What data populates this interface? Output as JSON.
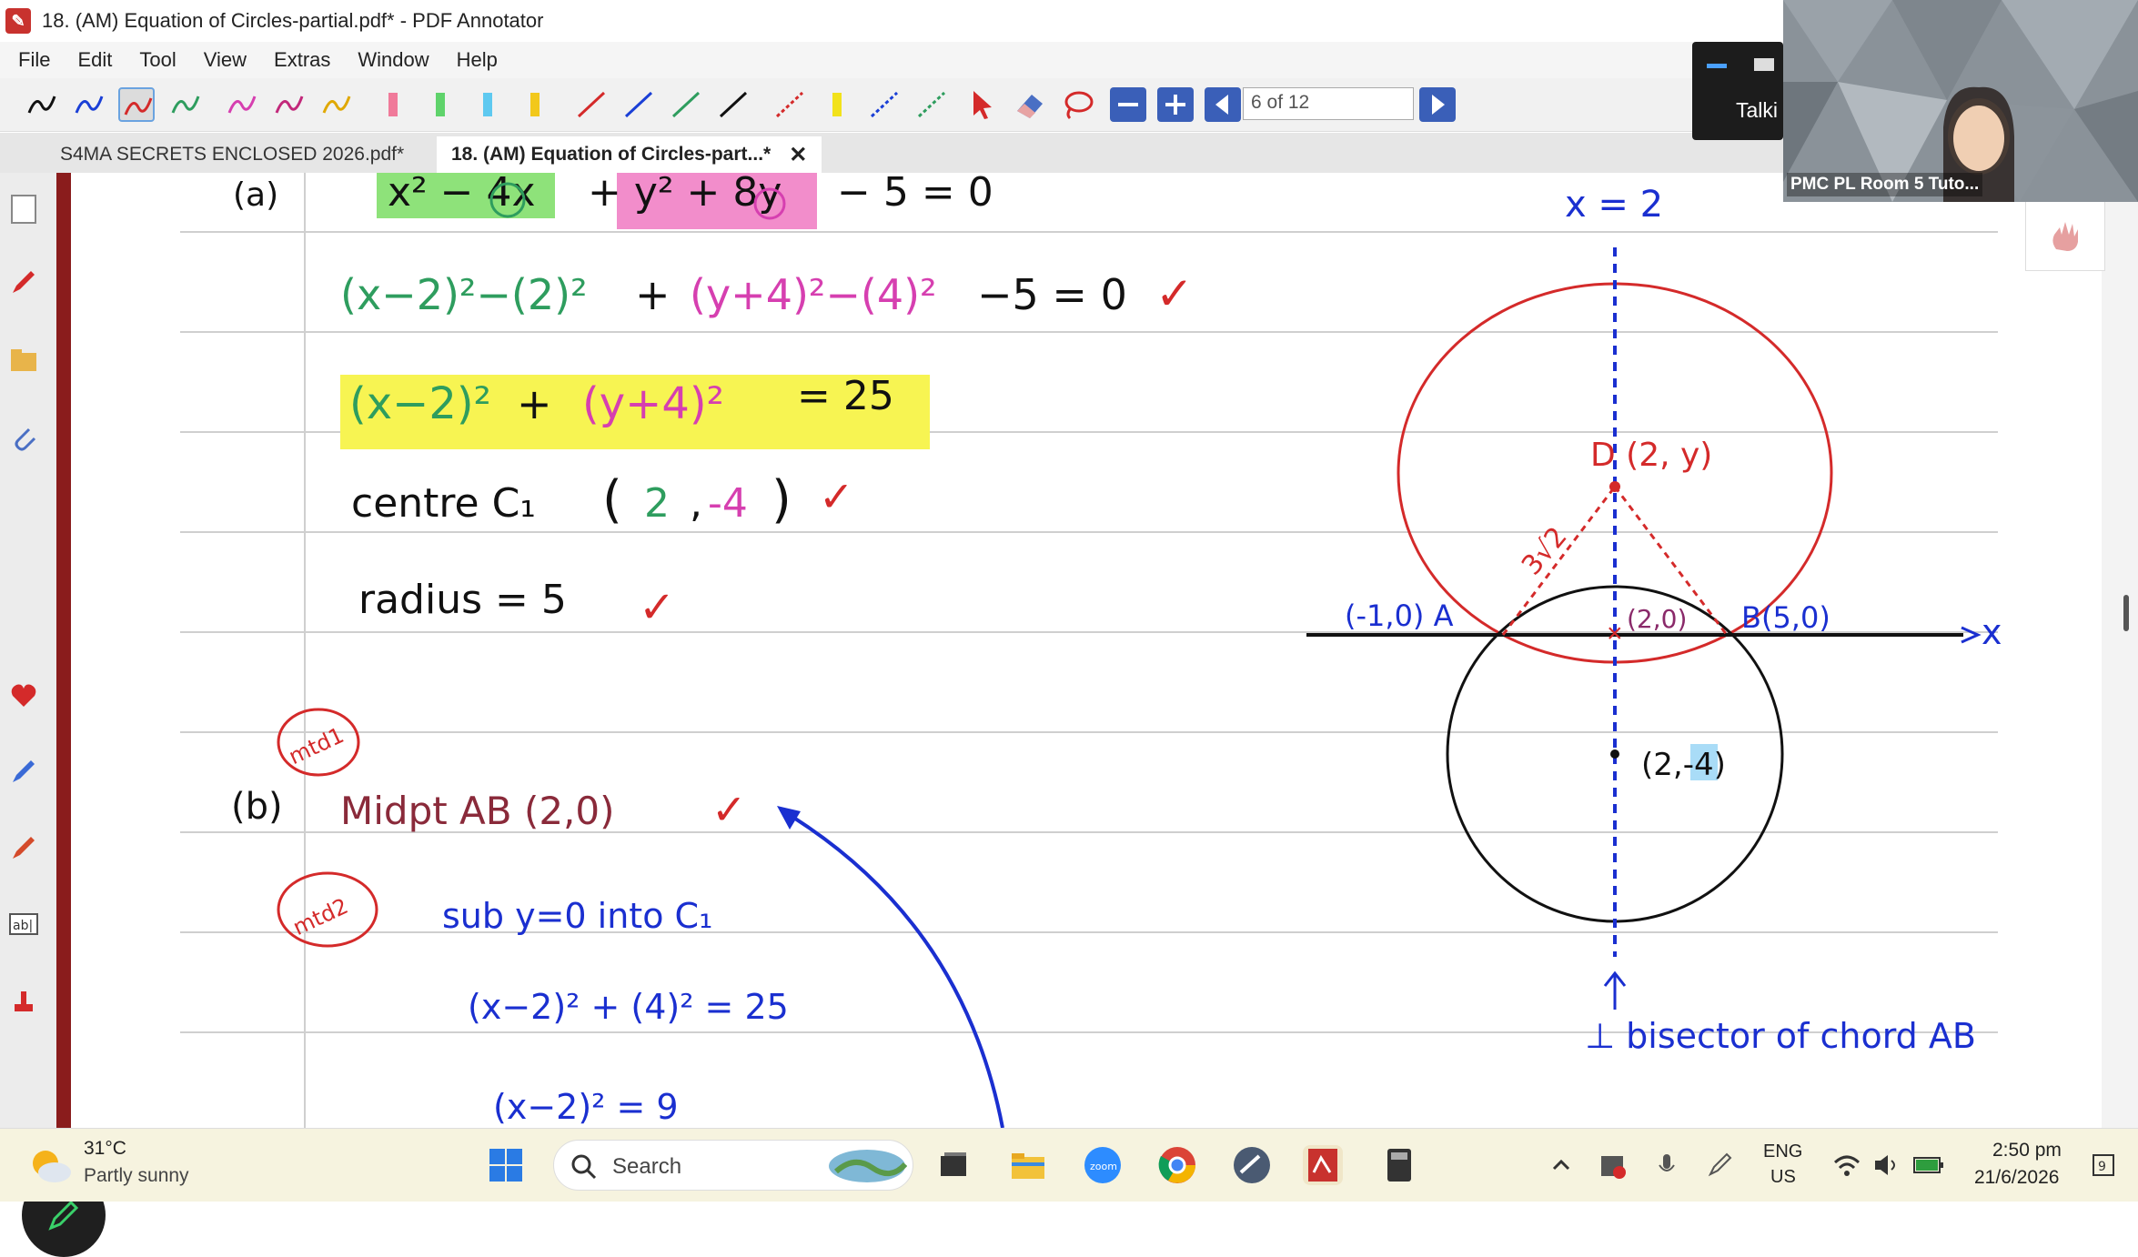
{
  "window": {
    "title": "18. (AM) Equation of Circles-partial.pdf* - PDF Annotator",
    "app_icon": "pdf-annotator-icon"
  },
  "menu": [
    "File",
    "Edit",
    "Tool",
    "View",
    "Extras",
    "Window",
    "Help"
  ],
  "toolbar": {
    "page_indicator": "6 of 12",
    "pen_colors": [
      "#111111",
      "#1a3fd6",
      "#d42a2a",
      "#2e9d5e",
      "#d63fb0",
      "#c2287a",
      "#e0a800"
    ],
    "highlighter_colors": [
      "#f07a9a",
      "#5fd36b",
      "#5ec9f0",
      "#f2c81b"
    ],
    "line_colors": [
      "#d42a2a",
      "#1a3fd6",
      "#2e9d5e",
      "#111111"
    ],
    "dashed_colors": [
      "#d42a2a",
      "#f2d81b",
      "#1a3fd6",
      "#2e9d5e"
    ]
  },
  "tabs": [
    {
      "label": "S4MA SECRETS ENCLOSED 2026.pdf*",
      "active": false
    },
    {
      "label": "18. (AM) Equation of Circles-part...*",
      "active": true
    }
  ],
  "zoom": {
    "panel_label": "Talki",
    "participant_name": "PMC PL Room 5 Tuto..."
  },
  "notes": {
    "a_label": "(a)",
    "a_line1_x": "x² − 4x",
    "a_line1_y": "+ y² + 8y",
    "a_line1_rest": "− 5 = 0",
    "a_line2_x": "(x−2)²−(2)²",
    "a_line2_plus": "+",
    "a_line2_y": "(y+4)²−(4)²",
    "a_line2_rest": "−5 = 0",
    "a_line3_x": "(x−2)²",
    "a_line3_plus": "+",
    "a_line3_y": "(y+4)²",
    "a_line3_rest": "= 25",
    "centre_label": "centre C₁",
    "centre_open": "(",
    "centre_x": "2",
    "centre_sep": ",",
    "centre_y": "-4",
    "centre_close": ")",
    "radius": "radius = 5",
    "check": "✓",
    "mtd1": "mtd1",
    "mtd2": "mtd2",
    "b_label": "(b)",
    "b_midpt": "Midpt AB (2,0)",
    "b_sub": "sub y=0 into C₁",
    "b_eq1": "(x−2)² + (4)² = 25",
    "b_eq2": "(x−2)² = 9"
  },
  "diagram": {
    "x_eq_label": "x = 2",
    "point_D": "D (2, y)",
    "point_A": "(-1,0) A",
    "point_B": "B(5,0)",
    "mid": "(2,0)",
    "center": "(2,-4)",
    "axis_label": "x",
    "dist_label": "3√2",
    "bisector": "⊥ bisector of chord AB",
    "colors": {
      "blue": "#1a2fd0",
      "red": "#d42a2a"
    }
  },
  "taskbar": {
    "weather_temp": "31°C",
    "weather_desc": "Partly sunny",
    "search": "Search",
    "lang1": "ENG",
    "lang2": "US",
    "time": "2:50 pm",
    "date": "21/6/2026"
  }
}
